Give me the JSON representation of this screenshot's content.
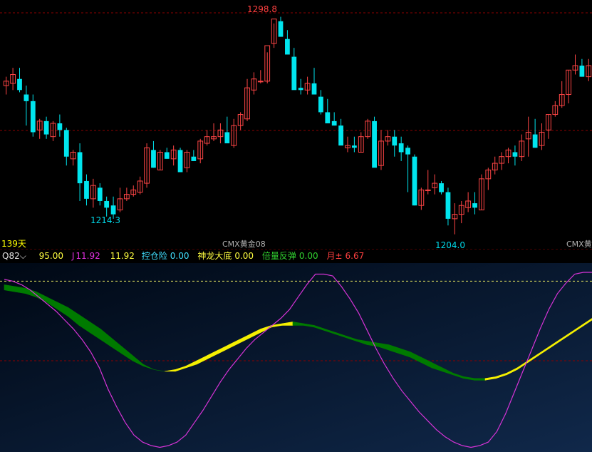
{
  "colors": {
    "up": "#ff4545",
    "down": "#00e5ee",
    "grid": "#8b0000",
    "env_green": "#007a00",
    "env_yellow": "#f5f000",
    "j_line": "#d633d6",
    "high_label": "#ff4040",
    "low_label": "#00d8e8"
  },
  "chart_data": [
    {
      "type": "candlestick",
      "title": "CMX黄金08",
      "labels": {
        "period_count": "139天",
        "symbol_mid": "CMX黄金08",
        "symbol_right": "CMX黄金"
      },
      "high_label": "1298.8",
      "low_labels": [
        "1214.3",
        "1204.0"
      ],
      "ylim": [
        1198,
        1304
      ],
      "grid": true,
      "candles": [
        [
          1268,
          1272,
          1264,
          1270
        ],
        [
          1269,
          1276,
          1266,
          1273
        ],
        [
          1271,
          1276,
          1265,
          1266
        ],
        [
          1264,
          1268,
          1250,
          1261
        ],
        [
          1261,
          1264,
          1245,
          1247
        ],
        [
          1248,
          1253,
          1244,
          1252
        ],
        [
          1252,
          1254,
          1244,
          1246
        ],
        [
          1245,
          1252,
          1243,
          1251
        ],
        [
          1251,
          1255,
          1245,
          1248
        ],
        [
          1248,
          1249,
          1232,
          1236
        ],
        [
          1235,
          1239,
          1232,
          1238
        ],
        [
          1238,
          1242,
          1216,
          1224
        ],
        [
          1225,
          1228,
          1214,
          1217
        ],
        [
          1217,
          1226,
          1213,
          1223
        ],
        [
          1222,
          1224,
          1214,
          1216
        ],
        [
          1216,
          1218,
          1209,
          1213
        ],
        [
          1214,
          1218,
          1208,
          1210
        ],
        [
          1212,
          1222,
          1211,
          1217
        ],
        [
          1217,
          1222,
          1216,
          1219
        ],
        [
          1219,
          1223,
          1218,
          1221
        ],
        [
          1220,
          1227,
          1219,
          1225
        ],
        [
          1224,
          1242,
          1222,
          1240
        ],
        [
          1239,
          1243,
          1231,
          1231
        ],
        [
          1230,
          1239,
          1230,
          1238
        ],
        [
          1238,
          1240,
          1235,
          1235
        ],
        [
          1235,
          1241,
          1232,
          1239
        ],
        [
          1239,
          1240,
          1229,
          1229
        ],
        [
          1231,
          1239,
          1229,
          1238
        ],
        [
          1236,
          1239,
          1234,
          1234
        ],
        [
          1235,
          1244,
          1233,
          1243
        ],
        [
          1242,
          1248,
          1241,
          1245
        ],
        [
          1244,
          1251,
          1243,
          1245
        ],
        [
          1245,
          1251,
          1242,
          1248
        ],
        [
          1247,
          1254,
          1246,
          1242
        ],
        [
          1241,
          1253,
          1240,
          1250
        ],
        [
          1250,
          1256,
          1248,
          1255
        ],
        [
          1253,
          1271,
          1252,
          1267
        ],
        [
          1266,
          1274,
          1264,
          1271
        ],
        [
          1270,
          1275,
          1269,
          1270
        ],
        [
          1270,
          1283,
          1269,
          1286
        ],
        [
          1287,
          1296,
          1285,
          1298
        ],
        [
          1297,
          1299,
          1290,
          1290
        ],
        [
          1289,
          1293,
          1282,
          1282
        ],
        [
          1281,
          1285,
          1274,
          1266
        ],
        [
          1267,
          1271,
          1264,
          1266
        ],
        [
          1266,
          1272,
          1264,
          1269
        ],
        [
          1269,
          1276,
          1265,
          1264
        ],
        [
          1263,
          1266,
          1255,
          1256
        ],
        [
          1256,
          1262,
          1251,
          1251
        ],
        [
          1252,
          1256,
          1250,
          1250
        ],
        [
          1250,
          1253,
          1243,
          1241
        ],
        [
          1240,
          1245,
          1238,
          1241
        ],
        [
          1241,
          1245,
          1238,
          1240
        ],
        [
          1238,
          1247,
          1238,
          1245
        ],
        [
          1245,
          1253,
          1244,
          1252
        ],
        [
          1252,
          1254,
          1233,
          1231
        ],
        [
          1232,
          1248,
          1230,
          1243
        ],
        [
          1243,
          1248,
          1241,
          1245
        ],
        [
          1245,
          1248,
          1236,
          1241
        ],
        [
          1242,
          1245,
          1234,
          1238
        ],
        [
          1240,
          1241,
          1220,
          1237
        ],
        [
          1236,
          1237,
          1214,
          1214
        ],
        [
          1214,
          1222,
          1212,
          1221
        ],
        [
          1221,
          1230,
          1219,
          1221
        ],
        [
          1222,
          1228,
          1219,
          1224
        ],
        [
          1224,
          1225,
          1219,
          1220
        ],
        [
          1220,
          1222,
          1205,
          1208
        ],
        [
          1208,
          1215,
          1201,
          1210
        ],
        [
          1210,
          1216,
          1206,
          1214
        ],
        [
          1213,
          1220,
          1211,
          1216
        ],
        [
          1215,
          1220,
          1210,
          1213
        ],
        [
          1212,
          1228,
          1212,
          1226
        ],
        [
          1226,
          1231,
          1221,
          1230
        ],
        [
          1230,
          1236,
          1228,
          1233
        ],
        [
          1233,
          1238,
          1230,
          1236
        ],
        [
          1236,
          1240,
          1233,
          1239
        ],
        [
          1238,
          1241,
          1232,
          1236
        ],
        [
          1236,
          1246,
          1234,
          1243
        ],
        [
          1244,
          1254,
          1236,
          1247
        ],
        [
          1246,
          1253,
          1240,
          1240
        ],
        [
          1241,
          1251,
          1239,
          1247
        ],
        [
          1248,
          1255,
          1244,
          1255
        ],
        [
          1255,
          1261,
          1254,
          1259
        ],
        [
          1259,
          1270,
          1258,
          1264
        ],
        [
          1264,
          1275,
          1260,
          1275
        ],
        [
          1275,
          1282,
          1273,
          1277
        ],
        [
          1277,
          1280,
          1272,
          1272
        ],
        [
          1272,
          1280,
          1270,
          1277
        ]
      ]
    },
    {
      "type": "indicator",
      "title": "Q82",
      "values": {
        "level": "95.00",
        "j_label": "J",
        "j_value": "11.92",
        "k_value": "11.92",
        "kongcang_label": "控仓险",
        "kongcang_value": "0.00",
        "shenlong_label": "神龙大底",
        "shenlong_value": "0.00",
        "beiliang_label": "倍量反弹",
        "beiliang_value": "0.00",
        "yue_label": "月±",
        "yue_value": "6.67"
      },
      "ylim": [
        0,
        100
      ],
      "reference_levels": [
        95,
        50
      ],
      "grid": true,
      "j_line": [
        96,
        95,
        93,
        90,
        86,
        82,
        78,
        73,
        68,
        62,
        55,
        46,
        34,
        24,
        15,
        8,
        4,
        2,
        1,
        2,
        4,
        8,
        15,
        22,
        30,
        38,
        45,
        51,
        57,
        62,
        66,
        70,
        74,
        79,
        86,
        93,
        99,
        99,
        98,
        92,
        85,
        77,
        67,
        57,
        48,
        40,
        33,
        27,
        21,
        16,
        11,
        7,
        4,
        2,
        1,
        2,
        4,
        10,
        20,
        32,
        44,
        56,
        68,
        79,
        88,
        94,
        99,
        100,
        100
      ],
      "envelope_a": [
        93,
        92,
        91,
        89,
        86,
        83,
        80,
        76,
        72,
        68,
        63,
        58,
        53,
        48,
        45,
        44,
        45,
        47,
        50,
        53,
        56,
        59,
        62,
        65,
        68,
        70,
        71,
        72,
        71,
        70,
        68,
        66,
        64,
        62,
        61,
        60,
        59,
        57,
        55,
        52,
        49,
        46,
        43,
        41,
        40,
        40,
        41,
        43,
        46,
        50,
        54,
        58,
        62,
        66,
        70,
        74
      ],
      "envelope_b": [
        90,
        89,
        88,
        86,
        83,
        79,
        75,
        70,
        66,
        62,
        58,
        54,
        50,
        47,
        45,
        44,
        44,
        46,
        48,
        51,
        54,
        57,
        60,
        63,
        66,
        69,
        70,
        70,
        70,
        69,
        67,
        65,
        63,
        61,
        59,
        58,
        56,
        54,
        52,
        49,
        46,
        44,
        42,
        40,
        39,
        39,
        40,
        42,
        45,
        49,
        53,
        57,
        61,
        65,
        69,
        73
      ]
    }
  ]
}
